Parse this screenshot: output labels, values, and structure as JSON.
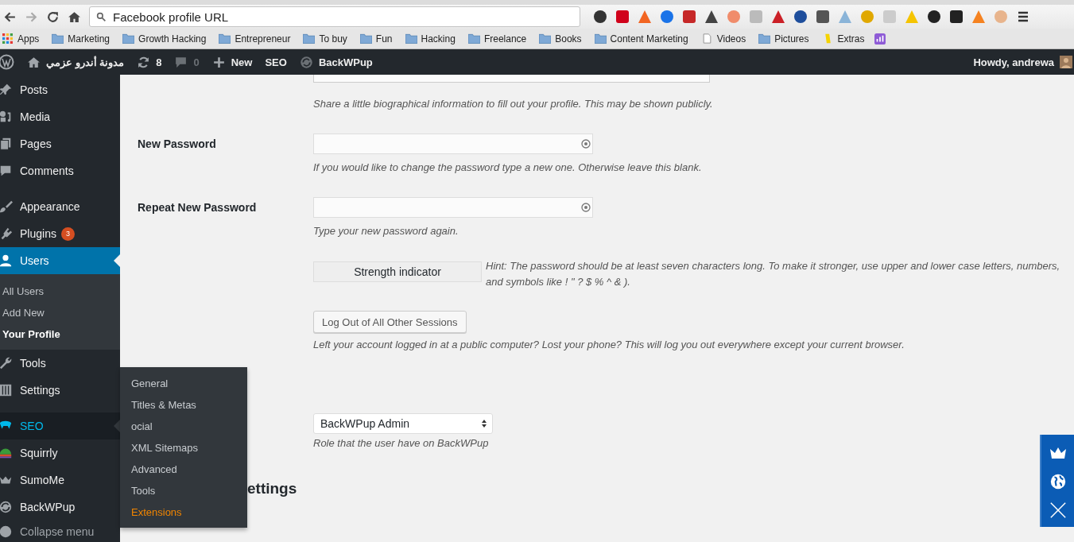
{
  "browser": {
    "address": "Facebook profile URL",
    "bookmarks": [
      {
        "label": "Apps",
        "kind": "apps"
      },
      {
        "label": "Marketing",
        "kind": "folder"
      },
      {
        "label": "Growth Hacking",
        "kind": "folder"
      },
      {
        "label": "Entrepreneur",
        "kind": "folder"
      },
      {
        "label": "To buy",
        "kind": "folder"
      },
      {
        "label": "Fun",
        "kind": "folder"
      },
      {
        "label": "Hacking",
        "kind": "folder"
      },
      {
        "label": "Freelance",
        "kind": "folder"
      },
      {
        "label": "Books",
        "kind": "folder"
      },
      {
        "label": "Content Marketing",
        "kind": "folder"
      },
      {
        "label": "Videos",
        "kind": "page"
      },
      {
        "label": "Pictures",
        "kind": "folder"
      },
      {
        "label": "Extras",
        "kind": "extras"
      }
    ]
  },
  "admin_bar": {
    "site_name": "مدونة أندرو عزمي",
    "updates": "8",
    "comments": "0",
    "new": "New",
    "links": [
      "SEO",
      "BackWPup"
    ],
    "greeting": "Howdy, andrewa"
  },
  "sidebar": {
    "groups": [
      {
        "items": [
          {
            "label": "Posts",
            "selected": false,
            "hover": false
          },
          {
            "label": "Media",
            "selected": false,
            "hover": false
          },
          {
            "label": "Pages",
            "selected": false,
            "hover": false
          },
          {
            "label": "Comments",
            "selected": false,
            "hover": false
          }
        ]
      },
      {
        "items": [
          {
            "label": "Appearance",
            "selected": false,
            "hover": false
          },
          {
            "label": "Plugins",
            "selected": false,
            "hover": false,
            "badge": "3"
          },
          {
            "label": "Users",
            "selected": true,
            "hover": false,
            "submenu": [
              {
                "label": "All Users",
                "selected": false
              },
              {
                "label": "Add New",
                "selected": false
              },
              {
                "label": "Your Profile",
                "selected": true
              }
            ]
          },
          {
            "label": "Tools",
            "selected": false,
            "hover": false
          },
          {
            "label": "Settings",
            "selected": false,
            "hover": false
          }
        ]
      },
      {
        "items": [
          {
            "label": "SEO",
            "selected": false,
            "hover": true
          },
          {
            "label": "Squirrly",
            "selected": false,
            "hover": false
          },
          {
            "label": "SumoMe",
            "selected": false,
            "hover": false
          },
          {
            "label": "BackWPup",
            "selected": false,
            "hover": false
          }
        ]
      }
    ],
    "collapse": "Collapse menu"
  },
  "flyout": {
    "items": [
      {
        "label": "General",
        "highlighted": false
      },
      {
        "label": "Titles & Metas",
        "highlighted": false
      },
      {
        "label": "ocial",
        "highlighted": false
      },
      {
        "label": "XML Sitemaps",
        "highlighted": false
      },
      {
        "label": "Advanced",
        "highlighted": false
      },
      {
        "label": "Tools",
        "highlighted": false
      },
      {
        "label": "Extensions",
        "highlighted": true
      }
    ]
  },
  "profile": {
    "bio_description": "Share a little biographical information to fill out your profile. This may be shown publicly.",
    "fields": [
      {
        "label": "New Password",
        "description": "If you would like to change the password type a new one. Otherwise leave this blank."
      },
      {
        "label": "Repeat New Password",
        "description": "Type your new password again."
      }
    ],
    "strength": "Strength indicator",
    "hint": "Hint: The password should be at least seven characters long. To make it stronger, use upper and lower case letters, numbers, and symbols like ! \" ? $ % ^ & ).",
    "sessions": {
      "button": "Log Out of All Other Sessions",
      "description": "Left your account logged in at a public computer? Lost your phone? This will log you out everywhere except your current browser."
    },
    "role": {
      "value": "BackWPup Admin",
      "description": "Role that the user have on BackWPup"
    },
    "heading": "ettings"
  }
}
